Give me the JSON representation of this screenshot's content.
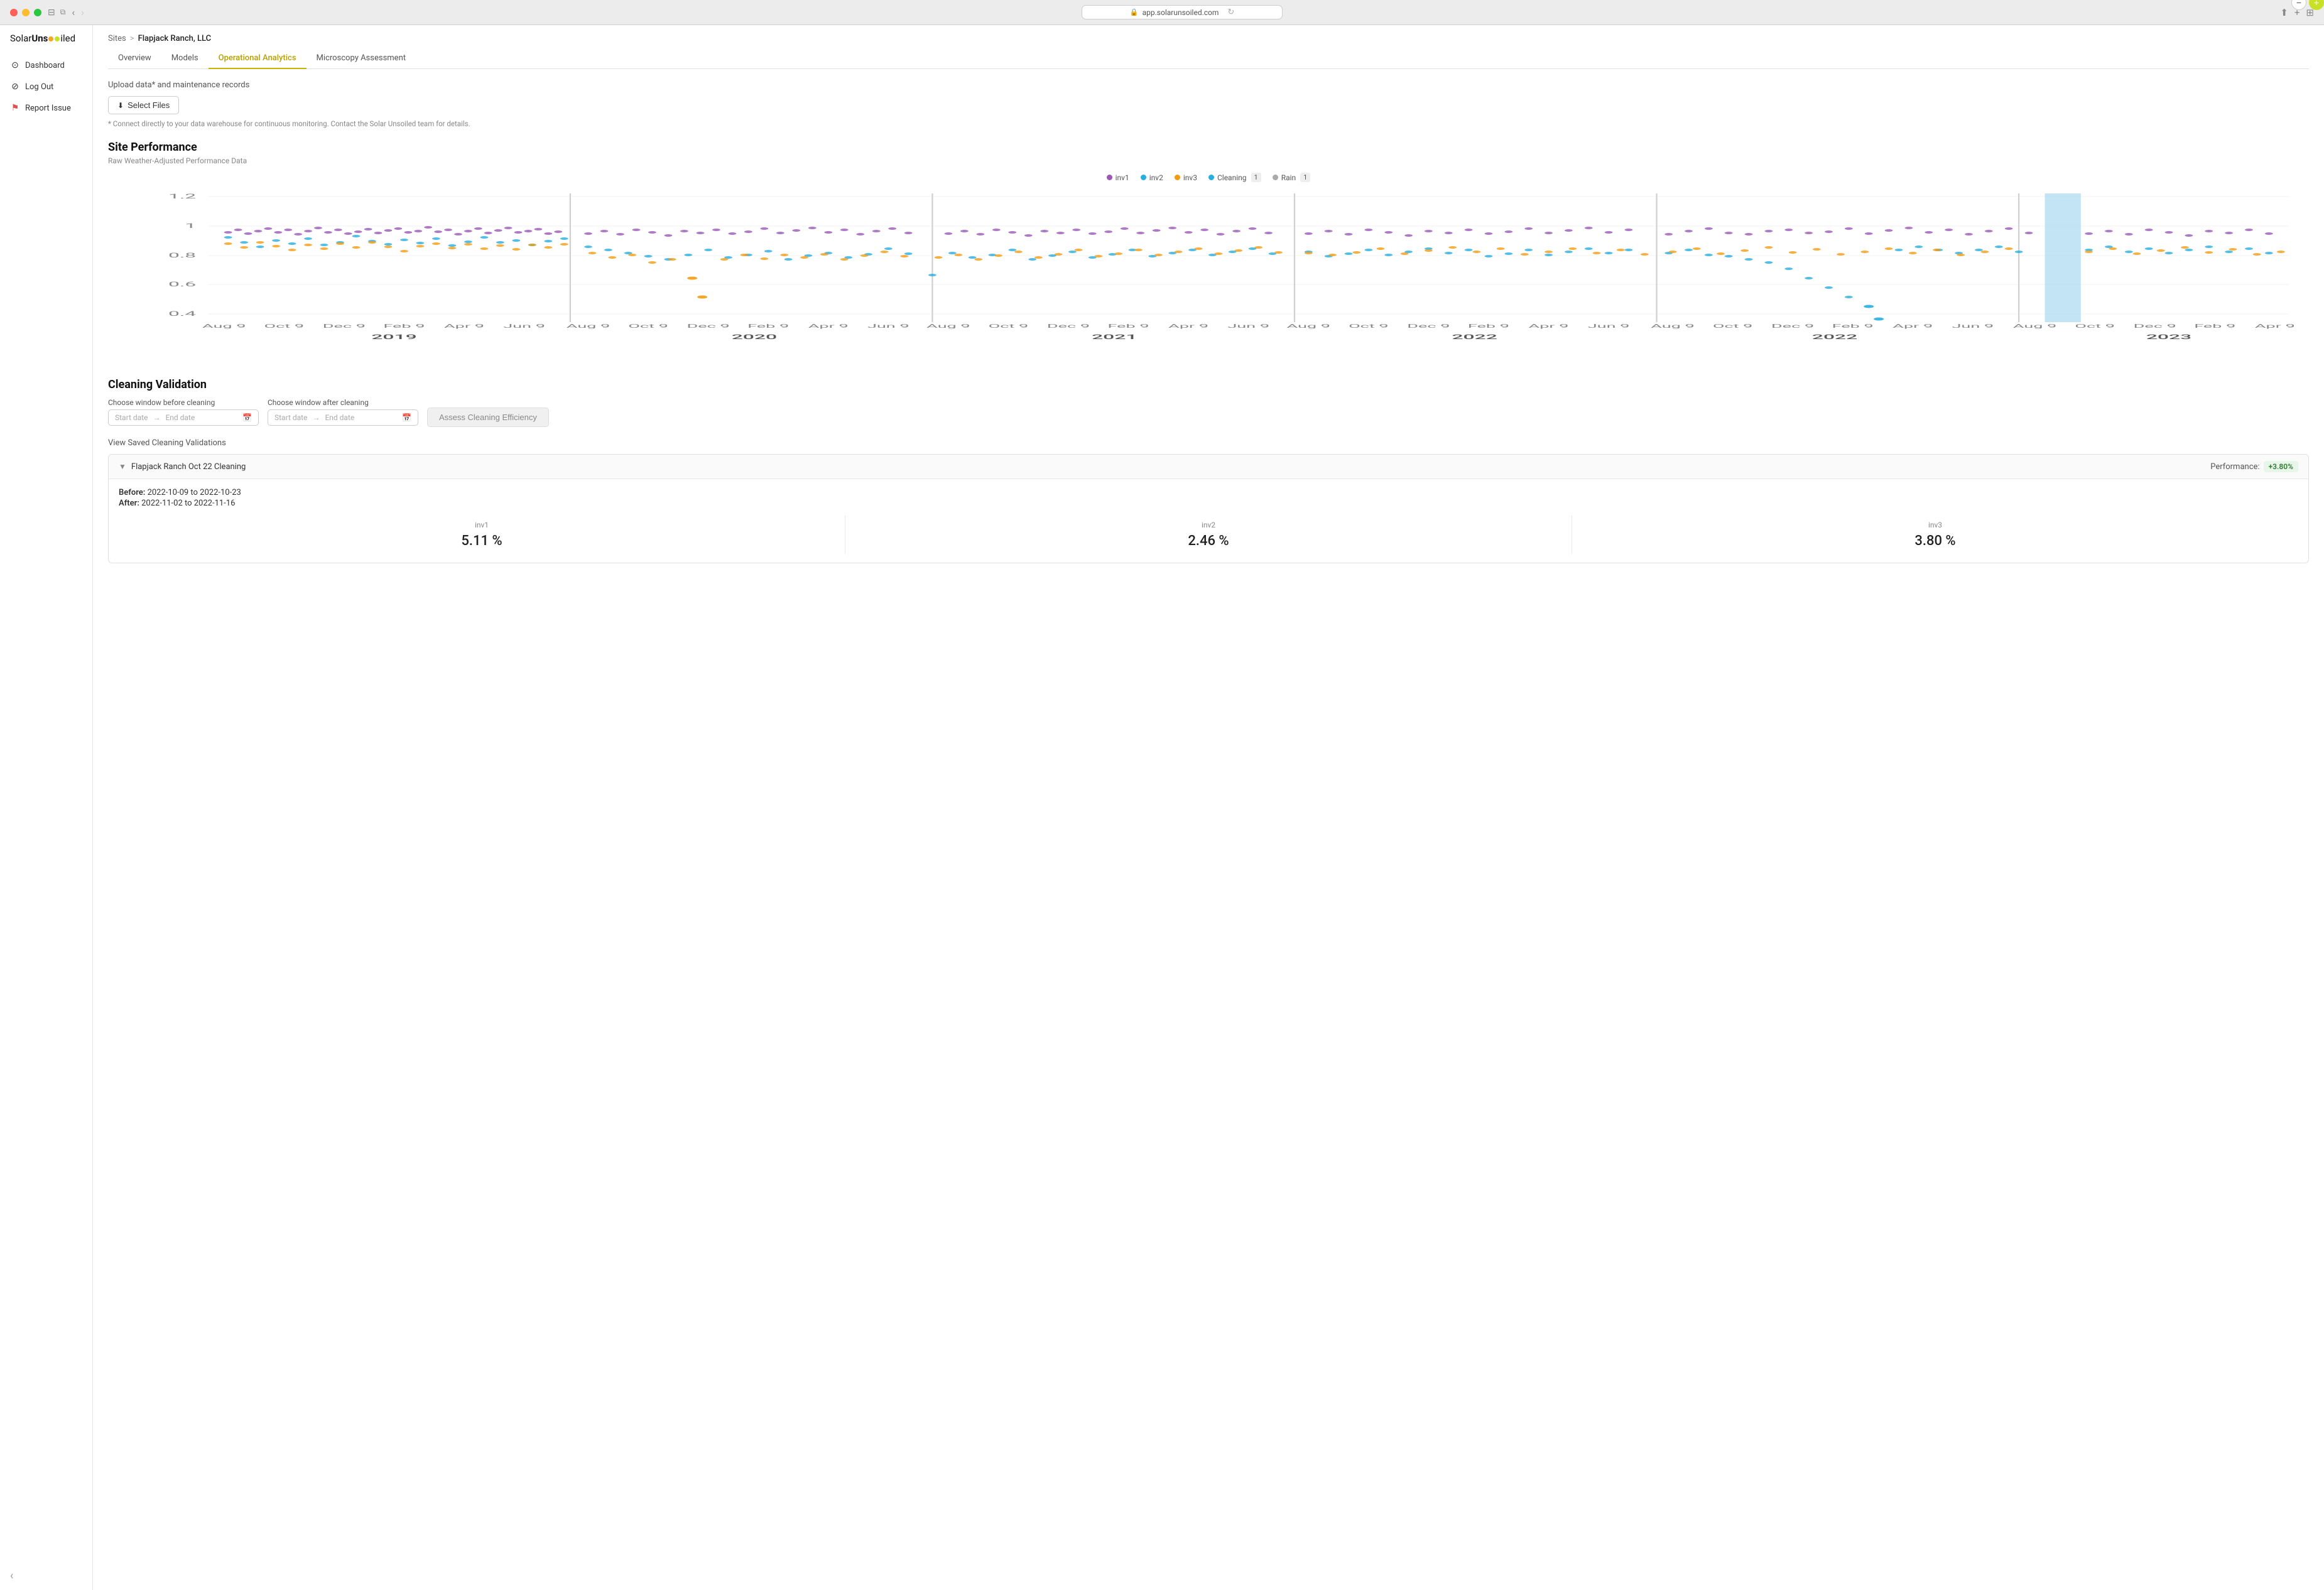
{
  "browser": {
    "url": "app.solarunsoiled.com",
    "lock_icon": "🔒"
  },
  "logo": {
    "prefix": "Solar",
    "bold": "Uns",
    "dot_color": "#f5a623",
    "dot2_color": "#c8e028",
    "suffix": "iled"
  },
  "sidebar": {
    "items": [
      {
        "id": "dashboard",
        "label": "Dashboard",
        "icon": "⊙"
      },
      {
        "id": "logout",
        "label": "Log Out",
        "icon": "⊘"
      },
      {
        "id": "report",
        "label": "Report Issue",
        "icon": "⚑"
      }
    ],
    "collapse_icon": "‹"
  },
  "breadcrumb": {
    "parent": "Sites",
    "separator": ">",
    "current": "Flapjack Ranch, LLC"
  },
  "tabs": [
    {
      "id": "overview",
      "label": "Overview",
      "active": false
    },
    {
      "id": "models",
      "label": "Models",
      "active": false
    },
    {
      "id": "operational",
      "label": "Operational Analytics",
      "active": true
    },
    {
      "id": "microscopy",
      "label": "Microscopy Assessment",
      "active": false
    }
  ],
  "upload": {
    "section_label": "Upload data* and maintenance records",
    "button_label": "Select Files",
    "button_icon": "⬇",
    "note": "* Connect directly to your data warehouse for continuous monitoring. Contact the Solar Unsoiled team for details."
  },
  "site_performance": {
    "title": "Site Performance",
    "subtitle": "Raw Weather-Adjusted Performance Data",
    "legend": [
      {
        "id": "inv1",
        "label": "inv1",
        "color": "#9b59b6"
      },
      {
        "id": "inv2",
        "label": "inv2",
        "color": "#27aee0"
      },
      {
        "id": "inv3",
        "label": "inv3",
        "color": "#f39c12"
      },
      {
        "id": "cleaning",
        "label": "Cleaning",
        "color": "#27aee0",
        "badge": "1"
      },
      {
        "id": "rain",
        "label": "Rain",
        "color": "#aaa",
        "badge": "1"
      }
    ],
    "y_axis": [
      "1.2",
      "1",
      "0.8",
      "0.6",
      "0.4"
    ],
    "x_labels": [
      "Aug 9",
      "Oct 9",
      "Dec 9",
      "Feb 9",
      "Apr 9",
      "Jun 9",
      "Aug 9",
      "Oct 9",
      "Dec 9",
      "Feb 9",
      "Apr 9",
      "Jun 9",
      "Aug 9",
      "Oct 9",
      "Dec 9",
      "Feb 9",
      "Apr 9",
      "Jun 9",
      "Aug 9",
      "Oct 9",
      "Dec 9",
      "Feb 9",
      "Apr 9",
      "Jun 9",
      "Aug 9",
      "Oct 9",
      "Dec 9",
      "Feb 9",
      "Apr 9",
      "Jun 9",
      "Aug 9",
      "Oct 9",
      "Dec 9"
    ],
    "year_labels": [
      {
        "year": "2019",
        "pos": 10
      },
      {
        "year": "2020",
        "pos": 24
      },
      {
        "year": "2021",
        "pos": 38
      },
      {
        "year": "2022",
        "pos": 52
      },
      {
        "year": "2023",
        "pos": 70
      }
    ],
    "zoom_minus": "−",
    "zoom_plus": "+"
  },
  "cleaning_validation": {
    "title": "Cleaning Validation",
    "before_label": "Choose window before cleaning",
    "after_label": "Choose window after cleaning",
    "start_placeholder": "Start date",
    "end_placeholder": "End date",
    "arrow": "→",
    "assess_label": "Assess Cleaning Efficiency",
    "saved_title": "View Saved Cleaning Validations"
  },
  "saved_validations": [
    {
      "id": "flapjack-oct22",
      "title": "Flapjack Ranch Oct 22 Cleaning",
      "performance_label": "Performance:",
      "performance_value": "+3.80%",
      "expanded": true,
      "before_label": "Before:",
      "before_range": "2022-10-09 to 2022-10-23",
      "after_label": "After:",
      "after_range": "2022-11-02 to 2022-11-16",
      "metrics": [
        {
          "id": "inv1",
          "label": "inv1",
          "value": "5.11 %"
        },
        {
          "id": "inv2",
          "label": "inv2",
          "value": "2.46 %"
        },
        {
          "id": "inv3",
          "label": "inv3",
          "value": "3.80 %"
        }
      ]
    }
  ]
}
